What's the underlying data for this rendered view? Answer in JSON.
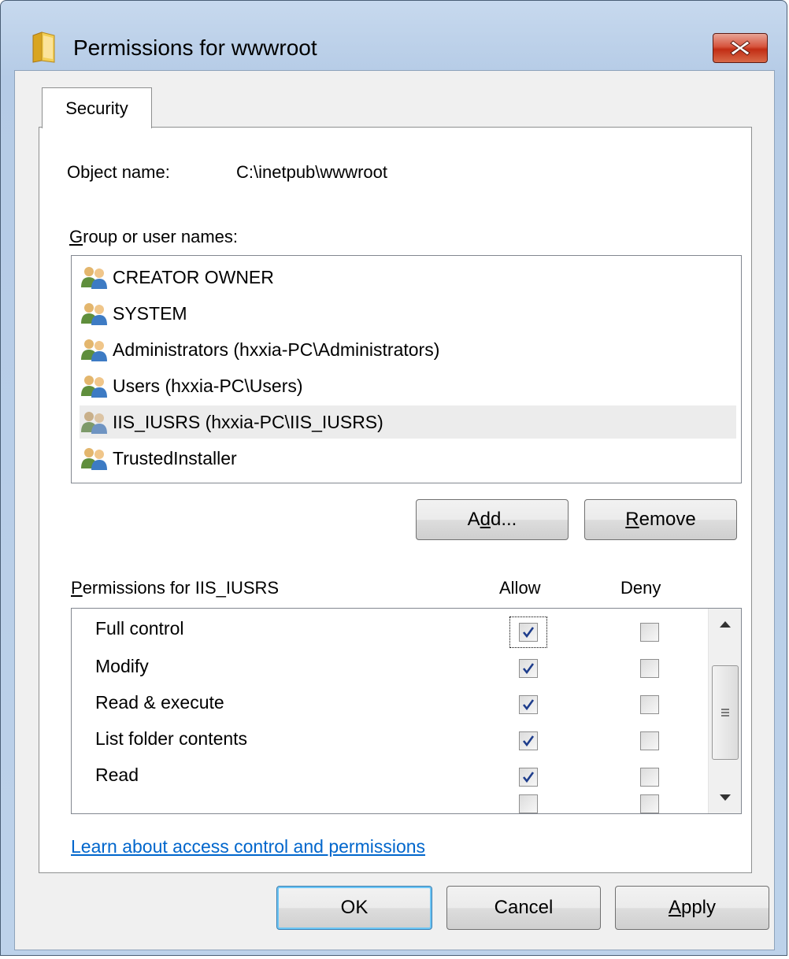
{
  "window": {
    "title": "Permissions for wwwroot",
    "close_label": "Close",
    "accent": "#c42b1c"
  },
  "tabs": [
    {
      "label": "Security"
    }
  ],
  "object": {
    "label": "Object name:",
    "value": "C:\\inetpub\\wwwroot"
  },
  "groups": {
    "label_prefix": "G",
    "label_rest": "roup or user names:",
    "items": [
      {
        "label": "CREATOR OWNER",
        "icon": "user-group-icon"
      },
      {
        "label": "SYSTEM",
        "icon": "user-group-icon"
      },
      {
        "label": "Administrators (hxxia-PC\\Administrators)",
        "icon": "user-group-icon"
      },
      {
        "label": "Users (hxxia-PC\\Users)",
        "icon": "user-group-icon"
      },
      {
        "label": "IIS_IUSRS (hxxia-PC\\IIS_IUSRS)",
        "icon": "user-group-icon",
        "selected": true
      },
      {
        "label": "TrustedInstaller",
        "icon": "user-group-icon"
      }
    ]
  },
  "buttons": {
    "add_pre": "A",
    "add_u": "d",
    "add_post": "d...",
    "remove_u": "R",
    "remove_post": "emove",
    "ok": "OK",
    "cancel": "Cancel",
    "apply_u": "A",
    "apply_post": "pply"
  },
  "permissions": {
    "title_u": "P",
    "title_rest": "ermissions for IIS_IUSRS",
    "allow_header": "Allow",
    "deny_header": "Deny",
    "rows": [
      {
        "name": "Full control",
        "allow": true,
        "deny": false
      },
      {
        "name": "Modify",
        "allow": true,
        "deny": false
      },
      {
        "name": "Read & execute",
        "allow": true,
        "deny": false
      },
      {
        "name": "List folder contents",
        "allow": true,
        "deny": false
      },
      {
        "name": "Read",
        "allow": true,
        "deny": false
      }
    ]
  },
  "link": {
    "text": "Learn about access control and permissions",
    "color": "#0066cc"
  }
}
